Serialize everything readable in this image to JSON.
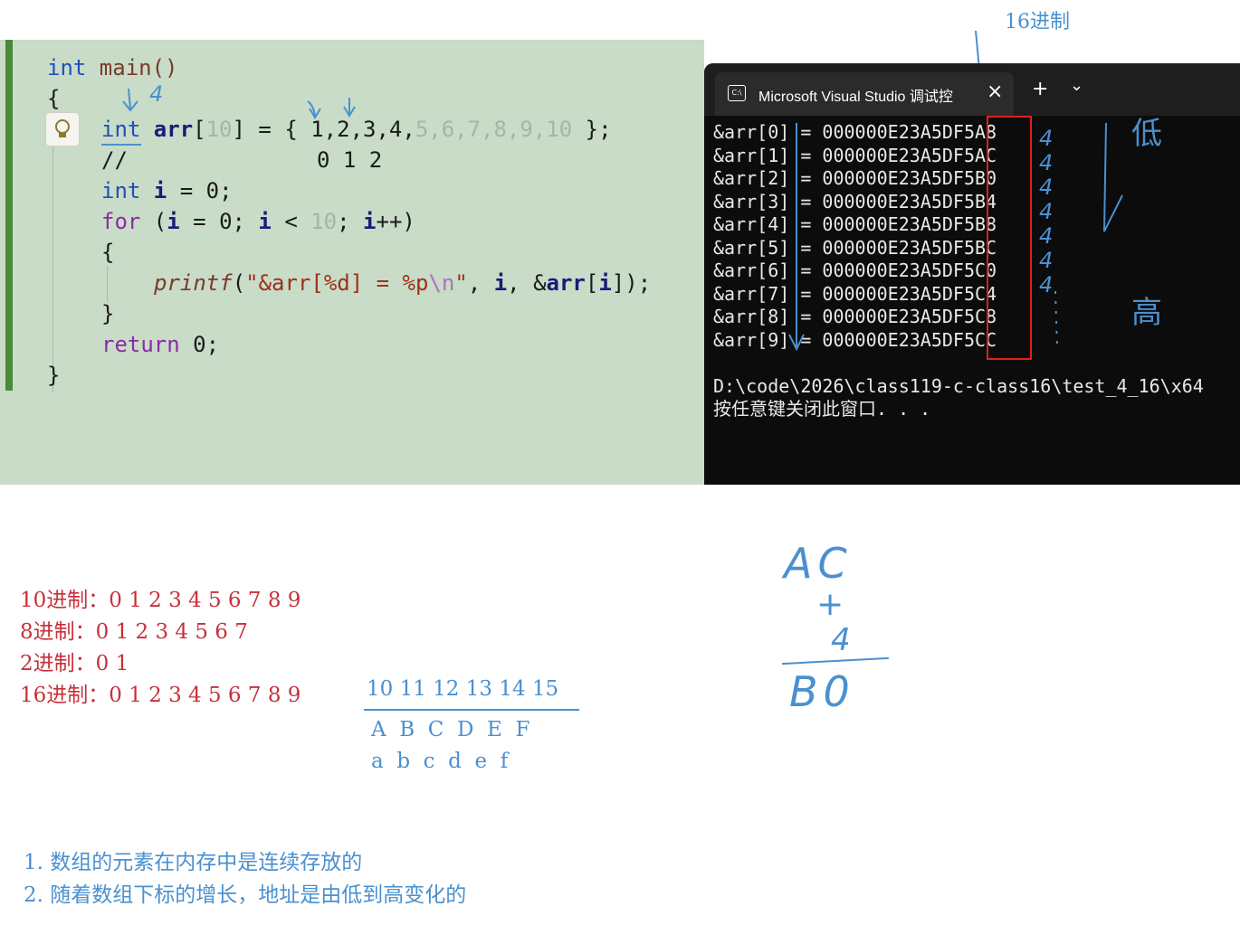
{
  "header_note": "16进制",
  "editor": {
    "lines": {
      "l1_kw": "int",
      "l1_fn": " main()",
      "l2": "{",
      "l3_kw": "int",
      "l3_var": " arr",
      "l3_open": "[",
      "l3_dim1": "10",
      "l3_rest": "] = { ",
      "l3_vals": "1,2,3,4,",
      "l3_dimvals": "5,6,7,8,9,10",
      "l3_end": " };",
      "l4_cm": "//",
      "l4_idx": "0 1 2",
      "l5_kw": "int",
      "l5_var": " i",
      "l5_rest": " = 0;",
      "l6_kw": "for",
      "l6_a": " (",
      "l6_i1": "i",
      "l6_b": " = 0; ",
      "l6_i2": "i",
      "l6_c": " < ",
      "l6_dim": "10",
      "l6_d": "; ",
      "l6_i3": "i",
      "l6_e": "++)",
      "l7": "{",
      "l8_fn": "printf",
      "l8_a": "(",
      "l8_str": "\"&arr[%d] = %p",
      "l8_esc": "\\n",
      "l8_str2": "\"",
      "l8_b": ", ",
      "l8_i": "i",
      "l8_c": ", &",
      "l8_arr": "arr",
      "l8_d": "[",
      "l8_i2": "i",
      "l8_e": "]);",
      "l9": "}",
      "l10_kw": "return",
      "l10_rest": " 0;",
      "l11": "}"
    },
    "annotation_arrow_note": "4"
  },
  "terminal": {
    "tab_title": "Microsoft Visual Studio 调试控",
    "close_icon": "×",
    "new_tab_icon": "+",
    "dropdown_icon": "⌄",
    "output_lines": [
      "&arr[0] = 000000E23A5DF5A8",
      "&arr[1] = 000000E23A5DF5AC",
      "&arr[2] = 000000E23A5DF5B0",
      "&arr[3] = 000000E23A5DF5B4",
      "&arr[4] = 000000E23A5DF5B8",
      "&arr[5] = 000000E23A5DF5BC",
      "&arr[6] = 000000E23A5DF5C0",
      "&arr[7] = 000000E23A5DF5C4",
      "&arr[8] = 000000E23A5DF5C8",
      "&arr[9] = 000000E23A5DF5CC"
    ],
    "path_line": "D:\\code\\2026\\class119-c-class16\\test_4_16\\x64",
    "prompt_line": "按任意键关闭此窗口. . .",
    "annotation_low": "低",
    "annotation_high": "高",
    "annotation_fours": [
      "4",
      "4",
      "4",
      "4",
      "4",
      "4",
      "4"
    ]
  },
  "bases": {
    "dec": "10进制：0 1 2 3 4 5 6 7 8 9",
    "oct": "8进制：0 1 2 3 4 5 6 7",
    "bin": "2进制：0 1",
    "hex_label": "16进制：0 1 2 3 4 5 6 7 8 9",
    "hex_ext": "10 11 12 13 14 15",
    "hex_upper": "A  B  C  D  E  F",
    "hex_lower": "a  b  c  d  e  f"
  },
  "calc": {
    "top": "AC",
    "plus": "+",
    "num": "4",
    "result": "B0"
  },
  "conclusions": [
    "1.  数组的元素在内存中是连续存放的",
    "2.  随着数组下标的增长，地址是由低到高变化的"
  ],
  "colors": {
    "editor_bg": "#c8dcc7",
    "terminal_bg": "#0c0c0c",
    "note_red": "#c8303a",
    "note_blue": "#4a90d0",
    "highlight_box": "#e02020"
  }
}
